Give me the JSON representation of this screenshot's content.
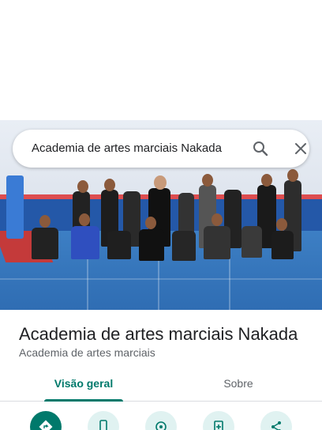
{
  "search": {
    "query": "Academia de artes marciais Nakada"
  },
  "place": {
    "title": "Academia de artes marciais Nakada",
    "category": "Academia de artes marciais"
  },
  "tabs": [
    {
      "label": "Visão geral",
      "selected": true
    },
    {
      "label": "Sobre",
      "selected": false
    }
  ],
  "actions": [
    {
      "icon": "directions-icon"
    },
    {
      "icon": "phone-icon"
    },
    {
      "icon": "location-icon"
    },
    {
      "icon": "save-icon"
    },
    {
      "icon": "share-icon"
    }
  ],
  "colors": {
    "accent": "#00796b",
    "action_bg": "#e0f2f1",
    "title": "#202124",
    "secondary": "#5f6368"
  }
}
